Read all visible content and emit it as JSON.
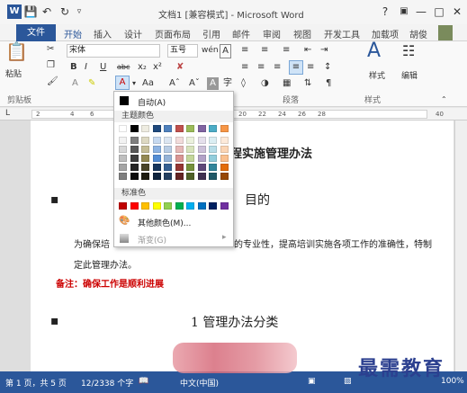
{
  "titlebar": {
    "title": "文档1 [兼容模式] - Microsoft Word",
    "help": "?",
    "minimize": "—",
    "restore": "□",
    "close": "✕"
  },
  "tabs": [
    "文件",
    "开始",
    "插入",
    "设计",
    "页面布局",
    "引用",
    "邮件",
    "审阅",
    "视图",
    "开发工具",
    "加载项"
  ],
  "user_name": "胡俊",
  "ribbon": {
    "paste_label": "粘贴",
    "font_name": "宋体",
    "font_size": "五号",
    "font_size_btn": "wén",
    "bold": "B",
    "italic": "I",
    "underline": "U",
    "strike": "abc",
    "subscript": "x₂",
    "superscript": "x²",
    "font_color_btn": "A",
    "case_btn": "Aa",
    "grow_font": "Aˆ",
    "shrink_font": "Aˇ",
    "char_shade": "A",
    "enclose_char": "字",
    "styles_label": "样式",
    "editing_label": "编辑",
    "groups": {
      "clipboard": "剪贴板",
      "paragraph": "段落",
      "styles": "样式"
    }
  },
  "ruler": {
    "numbers": [
      "2",
      "2",
      "4",
      "6",
      "20",
      "22",
      "24",
      "26",
      "28",
      "40"
    ]
  },
  "color_menu": {
    "automatic": "自动(A)",
    "theme_colors": "主题颜色",
    "standard_colors": "标准色",
    "more_colors": "其他颜色(M)...",
    "gradient": "渐变(G)",
    "theme_top_row": [
      "#ffffff",
      "#000000",
      "#eeece1",
      "#1f497d",
      "#4f81bd",
      "#c0504d",
      "#9bbb59",
      "#8064a2",
      "#4bacc6",
      "#f79646"
    ],
    "theme_shades": [
      [
        "#f2f2f2",
        "#7f7f7f",
        "#ddd9c3",
        "#c6d9f0",
        "#dbe5f1",
        "#f2dcdb",
        "#ebf1dd",
        "#e5e0ec",
        "#dbeef3",
        "#fdeada"
      ],
      [
        "#d8d8d8",
        "#595959",
        "#c4bd97",
        "#8db3e2",
        "#b8cce4",
        "#e5b9b7",
        "#d7e3bc",
        "#ccc1d9",
        "#b7dde8",
        "#fbd5b5"
      ],
      [
        "#bfbfbf",
        "#3f3f3f",
        "#938953",
        "#548dd4",
        "#95b3d7",
        "#d99694",
        "#c3d69b",
        "#b2a2c7",
        "#92cddc",
        "#fac08f"
      ],
      [
        "#a5a5a5",
        "#262626",
        "#494429",
        "#17365d",
        "#366092",
        "#953734",
        "#76923c",
        "#5f497a",
        "#31859b",
        "#e36c09"
      ],
      [
        "#7f7f7f",
        "#0c0c0c",
        "#1d1b10",
        "#0f243e",
        "#244061",
        "#632423",
        "#4f6128",
        "#3f3151",
        "#205867",
        "#974806"
      ]
    ],
    "standard": [
      "#c00000",
      "#ff0000",
      "#ffc000",
      "#ffff00",
      "#92d050",
      "#00b050",
      "#00b0f0",
      "#0070c0",
      "#002060",
      "#7030a0"
    ]
  },
  "document": {
    "heading_partial": "程实施管理办法",
    "section_purpose": "目的",
    "para_start": "为确保培",
    "para_mid": "的专业性，提高培训实施各项工作的准确性，特制",
    "para_line2": "定此管理办法。",
    "note": "备注：确保工作是顺利进展",
    "section1": "1  管理办法分类"
  },
  "status": {
    "page": "第 1 页，共 5 页",
    "words": "12/2338 个字",
    "lang": "中文(中国)",
    "zoom": "100%"
  },
  "watermark": "最需教育"
}
